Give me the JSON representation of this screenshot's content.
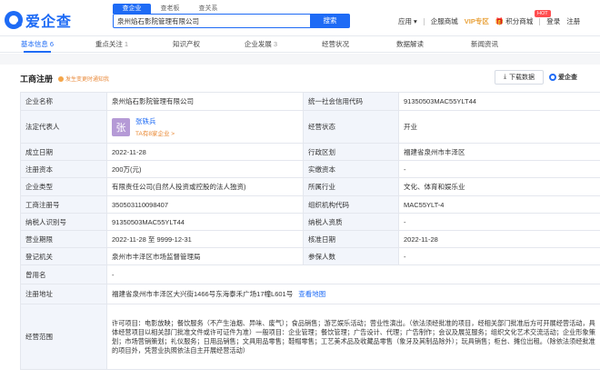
{
  "logo": {
    "text": "爱企查"
  },
  "search": {
    "tabs": [
      "查企业",
      "查老板",
      "查关系"
    ],
    "value": "泉州焰石影院管理有限公司",
    "button": "搜索"
  },
  "nav": {
    "app": "应用",
    "mall": "企服商城",
    "vip": "VIP专区",
    "hot": "HOT",
    "points": "积分商城",
    "login": "登录",
    "register": "注册"
  },
  "tabs": [
    {
      "label": "基本信息",
      "count": "6"
    },
    {
      "label": "重点关注",
      "count": "1"
    },
    {
      "label": "知识产权",
      "count": ""
    },
    {
      "label": "企业发展",
      "count": "3"
    },
    {
      "label": "经营状况",
      "count": ""
    },
    {
      "label": "数据解读",
      "count": ""
    },
    {
      "label": "新闻资讯",
      "count": ""
    }
  ],
  "section": {
    "title": "工商注册",
    "warn": "发生变更时通知我",
    "download": "下载数据",
    "brand": "爱企查"
  },
  "rows": {
    "r1": {
      "l1": "企业名称",
      "v1": "泉州焰石影院管理有限公司",
      "l2": "统一社会信用代码",
      "v2": "91350503MAC55YLT44"
    },
    "r2": {
      "l1": "法定代表人",
      "avatar": "张",
      "name": "张轶兵",
      "sub": "TA有8家企业 >",
      "l2": "经营状态",
      "v2": "开业"
    },
    "r3": {
      "l1": "成立日期",
      "v1": "2022-11-28",
      "l2": "行政区划",
      "v2": "福建省泉州市丰泽区"
    },
    "r4": {
      "l1": "注册资本",
      "v1": "200万(元)",
      "l2": "实缴资本",
      "v2": "-"
    },
    "r5": {
      "l1": "企业类型",
      "v1": "有限责任公司(自然人投资或控股的法人独资)",
      "l2": "所属行业",
      "v2": "文化、体育和娱乐业"
    },
    "r6": {
      "l1": "工商注册号",
      "v1": "350503110098407",
      "l2": "组织机构代码",
      "v2": "MAC55YLT-4"
    },
    "r7": {
      "l1": "纳税人识别号",
      "v1": "91350503MAC55YLT44",
      "l2": "纳税人资质",
      "v2": "-"
    },
    "r8": {
      "l1": "营业期限",
      "v1": "2022-11-28 至 9999-12-31",
      "l2": "核准日期",
      "v2": "2022-11-28"
    },
    "r9": {
      "l1": "登记机关",
      "v1": "泉州市丰泽区市场监督管理局",
      "l2": "参保人数",
      "v2": "-"
    },
    "r10": {
      "l1": "曾用名",
      "v1": "-"
    },
    "r11": {
      "l1": "注册地址",
      "v1": "福建省泉州市丰泽区大兴街1466号东海泰禾广场17幢L601号",
      "link": "查看地图"
    },
    "r12": {
      "l1": "经营范围",
      "v1": "许可项目：电影放映；餐饮服务（不产生油烟、异味、废气）；食品销售；游艺娱乐活动；营业性演出。（依法须经批准的项目，经相关部门批准后方可开展经营活动，具体经营项目以相关部门批准文件或许可证件为准）一般项目：企业管理；餐饮管理；广告设计、代理；广告制作；会议及展览服务；组织文化艺术交流活动；企业形象策划；市场营销策划；礼仪服务；日用品销售；文具用品零售；鞋帽零售；工艺美术品及收藏品零售（象牙及其制品除外）；玩具销售；柜台、摊位出租。（除依法须经批准的项目外，凭营业执照依法自主开展经营活动）"
    }
  }
}
